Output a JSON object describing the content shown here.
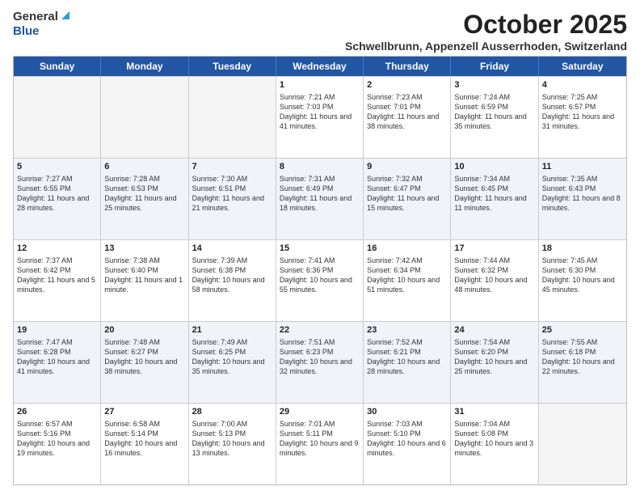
{
  "header": {
    "logo_general": "General",
    "logo_blue": "Blue",
    "month_title": "October 2025",
    "location": "Schwellbrunn, Appenzell Ausserrhoden, Switzerland"
  },
  "days": [
    "Sunday",
    "Monday",
    "Tuesday",
    "Wednesday",
    "Thursday",
    "Friday",
    "Saturday"
  ],
  "rows": [
    [
      {
        "date": "",
        "info": ""
      },
      {
        "date": "",
        "info": ""
      },
      {
        "date": "",
        "info": ""
      },
      {
        "date": "1",
        "info": "Sunrise: 7:21 AM\nSunset: 7:03 PM\nDaylight: 11 hours and 41 minutes."
      },
      {
        "date": "2",
        "info": "Sunrise: 7:23 AM\nSunset: 7:01 PM\nDaylight: 11 hours and 38 minutes."
      },
      {
        "date": "3",
        "info": "Sunrise: 7:24 AM\nSunset: 6:59 PM\nDaylight: 11 hours and 35 minutes."
      },
      {
        "date": "4",
        "info": "Sunrise: 7:25 AM\nSunset: 6:57 PM\nDaylight: 11 hours and 31 minutes."
      }
    ],
    [
      {
        "date": "5",
        "info": "Sunrise: 7:27 AM\nSunset: 6:55 PM\nDaylight: 11 hours and 28 minutes."
      },
      {
        "date": "6",
        "info": "Sunrise: 7:28 AM\nSunset: 6:53 PM\nDaylight: 11 hours and 25 minutes."
      },
      {
        "date": "7",
        "info": "Sunrise: 7:30 AM\nSunset: 6:51 PM\nDaylight: 11 hours and 21 minutes."
      },
      {
        "date": "8",
        "info": "Sunrise: 7:31 AM\nSunset: 6:49 PM\nDaylight: 11 hours and 18 minutes."
      },
      {
        "date": "9",
        "info": "Sunrise: 7:32 AM\nSunset: 6:47 PM\nDaylight: 11 hours and 15 minutes."
      },
      {
        "date": "10",
        "info": "Sunrise: 7:34 AM\nSunset: 6:45 PM\nDaylight: 11 hours and 11 minutes."
      },
      {
        "date": "11",
        "info": "Sunrise: 7:35 AM\nSunset: 6:43 PM\nDaylight: 11 hours and 8 minutes."
      }
    ],
    [
      {
        "date": "12",
        "info": "Sunrise: 7:37 AM\nSunset: 6:42 PM\nDaylight: 11 hours and 5 minutes."
      },
      {
        "date": "13",
        "info": "Sunrise: 7:38 AM\nSunset: 6:40 PM\nDaylight: 11 hours and 1 minute."
      },
      {
        "date": "14",
        "info": "Sunrise: 7:39 AM\nSunset: 6:38 PM\nDaylight: 10 hours and 58 minutes."
      },
      {
        "date": "15",
        "info": "Sunrise: 7:41 AM\nSunset: 6:36 PM\nDaylight: 10 hours and 55 minutes."
      },
      {
        "date": "16",
        "info": "Sunrise: 7:42 AM\nSunset: 6:34 PM\nDaylight: 10 hours and 51 minutes."
      },
      {
        "date": "17",
        "info": "Sunrise: 7:44 AM\nSunset: 6:32 PM\nDaylight: 10 hours and 48 minutes."
      },
      {
        "date": "18",
        "info": "Sunrise: 7:45 AM\nSunset: 6:30 PM\nDaylight: 10 hours and 45 minutes."
      }
    ],
    [
      {
        "date": "19",
        "info": "Sunrise: 7:47 AM\nSunset: 6:28 PM\nDaylight: 10 hours and 41 minutes."
      },
      {
        "date": "20",
        "info": "Sunrise: 7:48 AM\nSunset: 6:27 PM\nDaylight: 10 hours and 38 minutes."
      },
      {
        "date": "21",
        "info": "Sunrise: 7:49 AM\nSunset: 6:25 PM\nDaylight: 10 hours and 35 minutes."
      },
      {
        "date": "22",
        "info": "Sunrise: 7:51 AM\nSunset: 6:23 PM\nDaylight: 10 hours and 32 minutes."
      },
      {
        "date": "23",
        "info": "Sunrise: 7:52 AM\nSunset: 6:21 PM\nDaylight: 10 hours and 28 minutes."
      },
      {
        "date": "24",
        "info": "Sunrise: 7:54 AM\nSunset: 6:20 PM\nDaylight: 10 hours and 25 minutes."
      },
      {
        "date": "25",
        "info": "Sunrise: 7:55 AM\nSunset: 6:18 PM\nDaylight: 10 hours and 22 minutes."
      }
    ],
    [
      {
        "date": "26",
        "info": "Sunrise: 6:57 AM\nSunset: 5:16 PM\nDaylight: 10 hours and 19 minutes."
      },
      {
        "date": "27",
        "info": "Sunrise: 6:58 AM\nSunset: 5:14 PM\nDaylight: 10 hours and 16 minutes."
      },
      {
        "date": "28",
        "info": "Sunrise: 7:00 AM\nSunset: 5:13 PM\nDaylight: 10 hours and 13 minutes."
      },
      {
        "date": "29",
        "info": "Sunrise: 7:01 AM\nSunset: 5:11 PM\nDaylight: 10 hours and 9 minutes."
      },
      {
        "date": "30",
        "info": "Sunrise: 7:03 AM\nSunset: 5:10 PM\nDaylight: 10 hours and 6 minutes."
      },
      {
        "date": "31",
        "info": "Sunrise: 7:04 AM\nSunset: 5:08 PM\nDaylight: 10 hours and 3 minutes."
      },
      {
        "date": "",
        "info": ""
      }
    ]
  ]
}
